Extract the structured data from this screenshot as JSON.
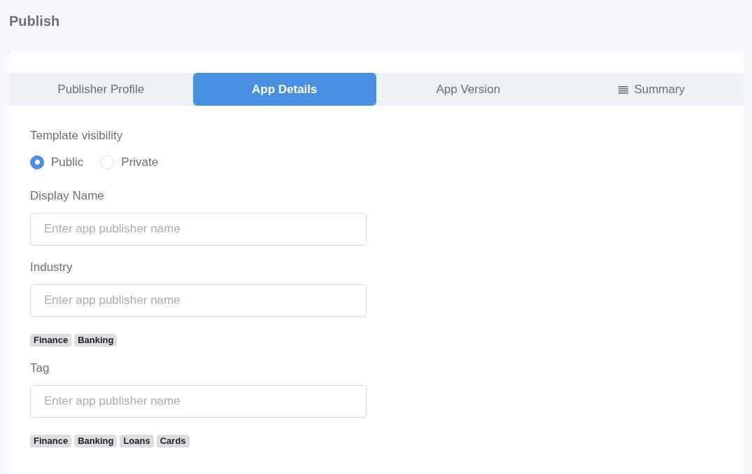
{
  "page_title": "Publish",
  "tabs": [
    {
      "label": "Publisher Profile",
      "selected": false,
      "kind": "plain"
    },
    {
      "label": "App Details",
      "selected": true,
      "kind": "plain"
    },
    {
      "label": "App Version",
      "selected": false,
      "kind": "plain"
    },
    {
      "label": "Summary",
      "selected": false,
      "kind": "list"
    }
  ],
  "fields": [
    {
      "kind": "radio",
      "label": "Template visibility",
      "options": [
        {
          "label": "Public",
          "selected": true
        },
        {
          "label": "Private",
          "selected": false
        }
      ]
    },
    {
      "kind": "input",
      "label": "Display Name",
      "placeholder": "Enter app publisher name"
    },
    {
      "kind": "input",
      "label": "Industry",
      "placeholder": "Enter app publisher name",
      "tags": [
        "Finance",
        "Banking"
      ]
    },
    {
      "kind": "input",
      "label": "Tag",
      "placeholder": "Enter app publisher name",
      "tags": [
        "Finance",
        "Banking",
        "Loans",
        "Cards"
      ]
    }
  ]
}
